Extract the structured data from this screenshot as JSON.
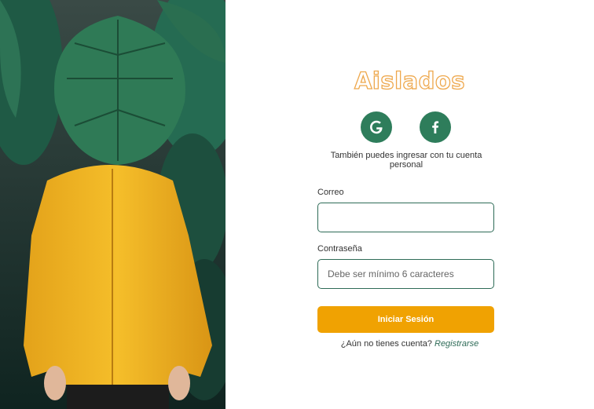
{
  "photo": {
    "alt_icon": "person-in-yellow-raincoat-photo"
  },
  "brand": {
    "name": "Aislados",
    "color": "#eea84d"
  },
  "social": {
    "google_icon": "google-icon",
    "facebook_icon": "facebook-icon",
    "color": "#2e7d5b",
    "hint": "También puedes ingresar con tu cuenta personal"
  },
  "form": {
    "email_label": "Correo",
    "email_value": "",
    "password_label": "Contraseña",
    "password_placeholder": "Debe ser mínimo 6 caracteres",
    "submit_label": "Iniciar Sesión",
    "submit_color": "#f0a202"
  },
  "footer": {
    "question": "¿Aún no tienes cuenta?",
    "signup_link": "Registrarse"
  }
}
